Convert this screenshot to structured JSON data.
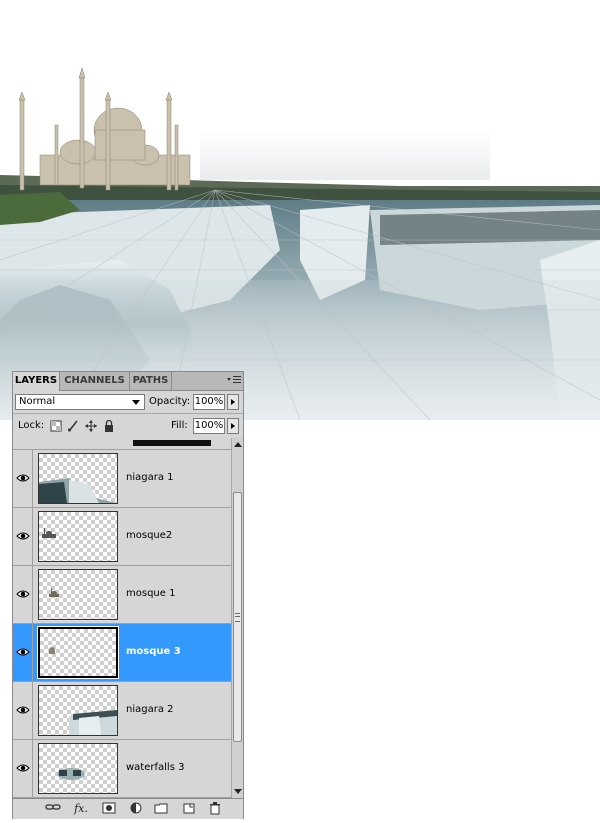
{
  "panel": {
    "tabs": [
      {
        "label": "LAYERS",
        "active": true
      },
      {
        "label": "CHANNELS",
        "active": false
      },
      {
        "label": "PATHS",
        "active": false
      }
    ],
    "blend_mode": "Normal",
    "opacity_label": "Opacity:",
    "opacity_value": "100%",
    "lock_label": "Lock:",
    "fill_label": "Fill:",
    "fill_value": "100%",
    "layers": [
      {
        "name": "niagara 1",
        "visible": true,
        "selected": false,
        "thumb_icon": "waterfall-thumb"
      },
      {
        "name": "mosque2",
        "visible": true,
        "selected": false,
        "thumb_icon": "mosque-thumb"
      },
      {
        "name": "mosque 1",
        "visible": true,
        "selected": false,
        "thumb_icon": "mosque-thumb"
      },
      {
        "name": "mosque 3",
        "visible": true,
        "selected": true,
        "thumb_icon": "mosque-thumb"
      },
      {
        "name": "niagara 2",
        "visible": true,
        "selected": false,
        "thumb_icon": "waterfall-thumb"
      },
      {
        "name": "waterfalls 3",
        "visible": true,
        "selected": false,
        "thumb_icon": "waterfall-thumb"
      }
    ],
    "bottom_icons": [
      "link-layers-icon",
      "fx-icon",
      "add-mask-icon",
      "adjustment-layer-icon",
      "new-group-icon",
      "new-layer-icon",
      "trash-icon"
    ],
    "colors": {
      "selected_row": "#3399ff",
      "panel_bg": "#d6d6d6"
    }
  }
}
